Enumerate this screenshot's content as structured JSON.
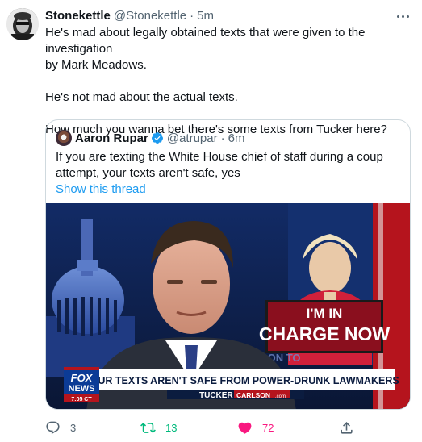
{
  "tweet": {
    "author_name": "Stonekettle",
    "author_handle": "@Stonekettle",
    "separator": "·",
    "time": "5m",
    "text": "He's mad about legally obtained texts that were given to the investigation\nby Mark Meadows.\n\nHe's not mad about the actual texts.\n\nHow much you wanna bet there's some texts from Tucker here?"
  },
  "quote": {
    "author_name": "Aaron Rupar",
    "author_handle": "@atrupar",
    "separator": "·",
    "time": "6m",
    "text": "If you are texting the White House chief of staff during a coup attempt, your texts aren't safe, yes",
    "show_thread": "Show this thread"
  },
  "media": {
    "banner_line1": "I'M IN",
    "banner_line2": "CHARGE NOW",
    "chyron": "YOUR TEXTS AREN'T SAFE FROM POWER-DRUNK LAWMAKERS",
    "show_name_part1": "TUCKER",
    "show_name_part2": "CARLSON",
    "show_name_domain": ".com",
    "logo_line1": "FOX",
    "logo_line2": "NEWS",
    "logo_time": "7:05 CT",
    "background_text": "LSON TO"
  },
  "actions": {
    "replies": "3",
    "retweets": "13",
    "likes": "72"
  },
  "colors": {
    "link": "#1d9bf0",
    "retweet_active": "#00ba7c",
    "like_active": "#f91880",
    "secondary_text": "#536471"
  },
  "icons": {
    "reply": "reply-icon",
    "retweet": "retweet-icon",
    "like": "heart-icon",
    "share": "share-icon",
    "more": "more-icon",
    "verified": "verified-badge-icon"
  }
}
